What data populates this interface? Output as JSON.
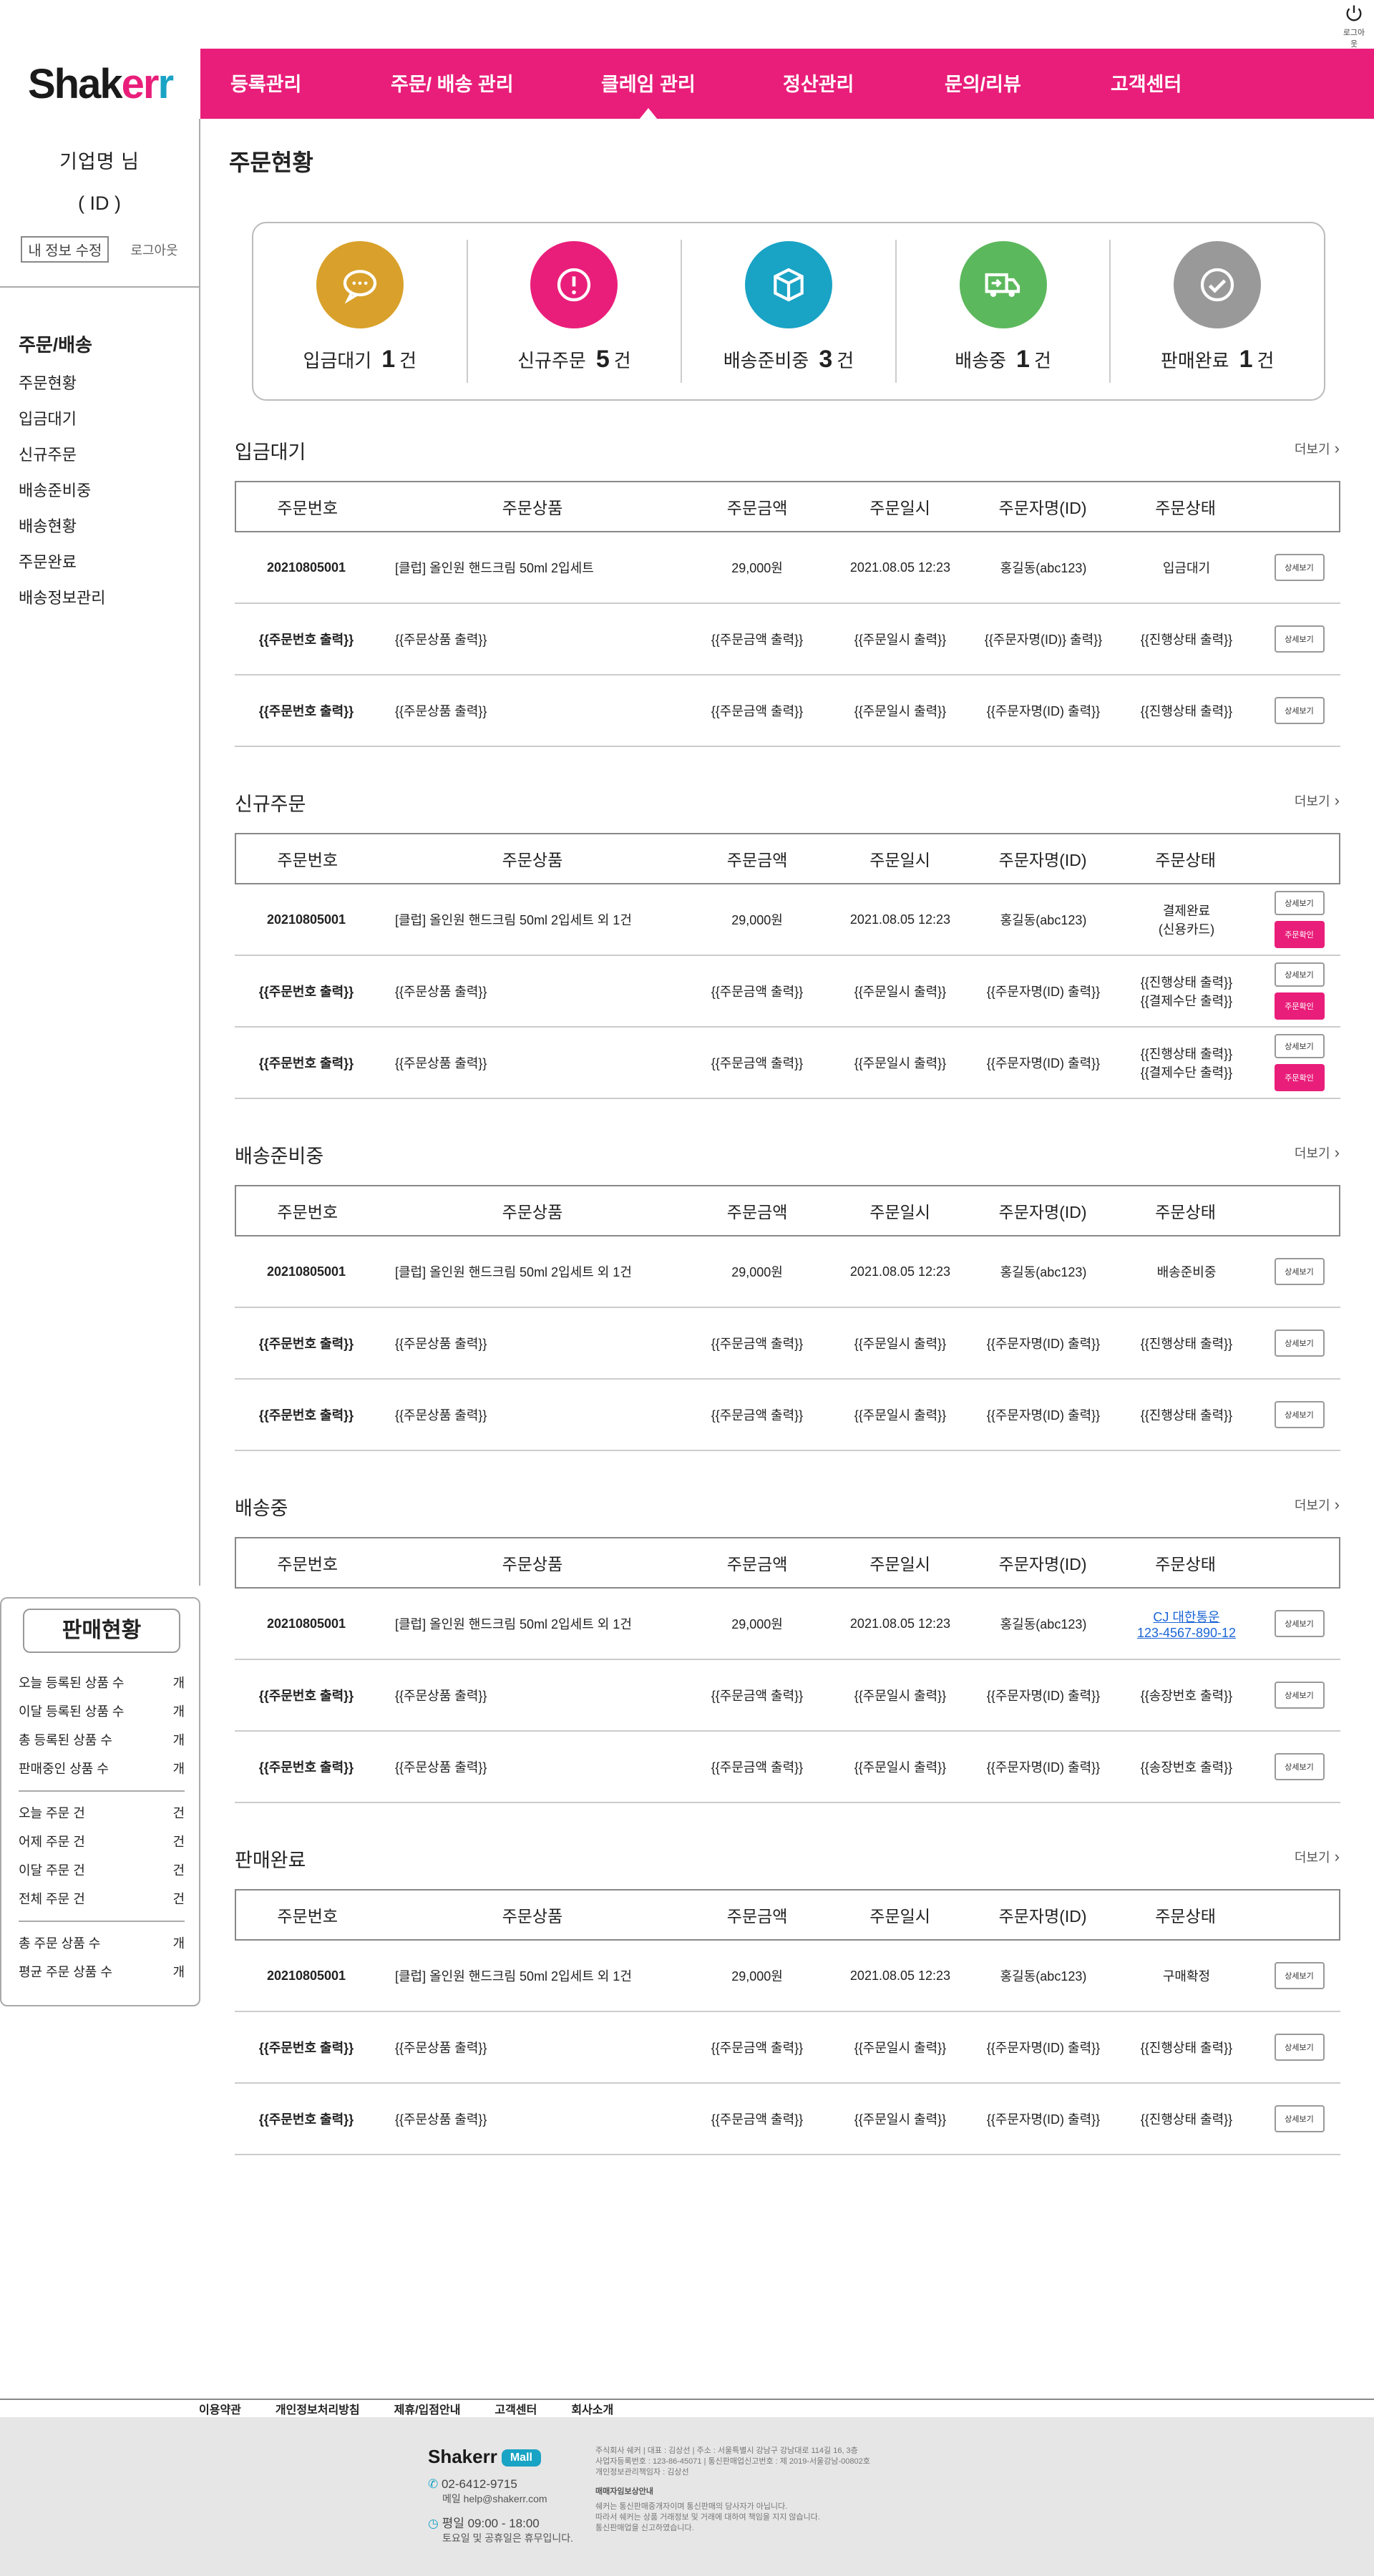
{
  "header": {
    "logout_label": "로그아웃",
    "logo_text": "Shakerr"
  },
  "nav": {
    "items": [
      {
        "label": "등록관리"
      },
      {
        "label": "주문/ 배송 관리"
      },
      {
        "label": "클레임 관리"
      },
      {
        "label": "정산관리"
      },
      {
        "label": "문의/리뷰"
      },
      {
        "label": "고객센터"
      }
    ],
    "active_index": 1
  },
  "sidebar": {
    "company": "기업명 님",
    "id": "( ID )",
    "my_info_label": "내 정보 수정",
    "logout_label": "로그아웃",
    "menu_head": "주문/배송",
    "menu": [
      "주문현황",
      "입금대기",
      "신규주문",
      "배송준비중",
      "배송현황",
      "주문완료",
      "배송정보관리"
    ]
  },
  "sales": {
    "title": "판매현황",
    "group1": [
      {
        "label": "오늘 등록된 상품 수",
        "unit": "개"
      },
      {
        "label": "이달 등록된 상품 수",
        "unit": "개"
      },
      {
        "label": "총 등록된 상품 수",
        "unit": "개"
      },
      {
        "label": "판매중인 상품 수",
        "unit": "개"
      }
    ],
    "group2": [
      {
        "label": "오늘 주문 건",
        "unit": "건"
      },
      {
        "label": "어제 주문 건",
        "unit": "건"
      },
      {
        "label": "이달 주문 건",
        "unit": "건"
      },
      {
        "label": "전체 주문 건",
        "unit": "건"
      }
    ],
    "group3": [
      {
        "label": "총 주문 상품 수",
        "unit": "개"
      },
      {
        "label": "평균 주문 상품 수",
        "unit": "개"
      }
    ]
  },
  "main": {
    "title": "주문현황"
  },
  "summary": [
    {
      "label": "입금대기",
      "count": "1",
      "unit": "건",
      "color": "#d9a12b",
      "icon": "chat-icon"
    },
    {
      "label": "신규주문",
      "count": "5",
      "unit": "건",
      "color": "#e91e7a",
      "icon": "alert-icon"
    },
    {
      "label": "배송준비중",
      "count": "3",
      "unit": "건",
      "color": "#19a3c5",
      "icon": "box-icon"
    },
    {
      "label": "배송중",
      "count": "1",
      "unit": "건",
      "color": "#5cb85c",
      "icon": "truck-icon"
    },
    {
      "label": "판매완료",
      "count": "1",
      "unit": "건",
      "color": "#999999",
      "icon": "check-icon"
    }
  ],
  "columns": [
    "주문번호",
    "주문상품",
    "주문금액",
    "주문일시",
    "주문자명(ID)",
    "주문상태"
  ],
  "more_label": "더보기",
  "detail_label": "상세보기",
  "confirm_label": "주문확인",
  "sections": [
    {
      "title": "입금대기",
      "rows": [
        {
          "no": "20210805001",
          "product": "[클럽] 올인원 핸드크림 50ml 2입세트",
          "amount": "29,000원",
          "date": "2021.08.05 12:23",
          "name": "홍길동(abc123)",
          "status": [
            "입금대기"
          ],
          "confirm": false
        },
        {
          "no": "{{주문번호 출력}}",
          "product": "{{주문상품 출력}}",
          "amount": "{{주문금액 출력}}",
          "date": "{{주문일시 출력}}",
          "name": "{{주문자명(ID)} 출력}}",
          "status": [
            "{{진행상태 출력}}"
          ],
          "confirm": false
        },
        {
          "no": "{{주문번호 출력}}",
          "product": "{{주문상품 출력}}",
          "amount": "{{주문금액 출력}}",
          "date": "{{주문일시 출력}}",
          "name": "{{주문자명(ID) 출력}}",
          "status": [
            "{{진행상태 출력}}"
          ],
          "confirm": false
        }
      ]
    },
    {
      "title": "신규주문",
      "rows": [
        {
          "no": "20210805001",
          "product": "[클럽] 올인원 핸드크림 50ml 2입세트 외 1건",
          "amount": "29,000원",
          "date": "2021.08.05 12:23",
          "name": "홍길동(abc123)",
          "status": [
            "결제완료",
            "(신용카드)"
          ],
          "confirm": true
        },
        {
          "no": "{{주문번호 출력}}",
          "product": "{{주문상품 출력}}",
          "amount": "{{주문금액 출력}}",
          "date": "{{주문일시 출력}}",
          "name": "{{주문자명(ID) 출력}}",
          "status": [
            "{{진행상태 출력}}",
            "{{결제수단 출력}}"
          ],
          "confirm": true
        },
        {
          "no": "{{주문번호 출력}}",
          "product": "{{주문상품 출력}}",
          "amount": "{{주문금액 출력}}",
          "date": "{{주문일시 출력}}",
          "name": "{{주문자명(ID) 출력}}",
          "status": [
            "{{진행상태 출력}}",
            "{{결제수단 출력}}"
          ],
          "confirm": true
        }
      ]
    },
    {
      "title": "배송준비중",
      "rows": [
        {
          "no": "20210805001",
          "product": "[클럽] 올인원 핸드크림 50ml 2입세트 외 1건",
          "amount": "29,000원",
          "date": "2021.08.05 12:23",
          "name": "홍길동(abc123)",
          "status": [
            "배송준비중"
          ],
          "confirm": false
        },
        {
          "no": "{{주문번호 출력}}",
          "product": "{{주문상품 출력}}",
          "amount": "{{주문금액 출력}}",
          "date": "{{주문일시 출력}}",
          "name": "{{주문자명(ID) 출력}}",
          "status": [
            "{{진행상태 출력}}"
          ],
          "confirm": false
        },
        {
          "no": "{{주문번호 출력}}",
          "product": "{{주문상품 출력}}",
          "amount": "{{주문금액 출력}}",
          "date": "{{주문일시 출력}}",
          "name": "{{주문자명(ID) 출력}}",
          "status": [
            "{{진행상태 출력}}"
          ],
          "confirm": false
        }
      ]
    },
    {
      "title": "배송중",
      "rows": [
        {
          "no": "20210805001",
          "product": "[클럽] 올인원 핸드크림 50ml 2입세트 외 1건",
          "amount": "29,000원",
          "date": "2021.08.05 12:23",
          "name": "홍길동(abc123)",
          "status": [
            "CJ 대한통운",
            "123-4567-890-12"
          ],
          "link": true,
          "confirm": false
        },
        {
          "no": "{{주문번호 출력}}",
          "product": "{{주문상품 출력}}",
          "amount": "{{주문금액 출력}}",
          "date": "{{주문일시 출력}}",
          "name": "{{주문자명(ID) 출력}}",
          "status": [
            "{{송장번호 출력}}"
          ],
          "confirm": false
        },
        {
          "no": "{{주문번호 출력}}",
          "product": "{{주문상품 출력}}",
          "amount": "{{주문금액 출력}}",
          "date": "{{주문일시 출력}}",
          "name": "{{주문자명(ID) 출력}}",
          "status": [
            "{{송장번호 출력}}"
          ],
          "confirm": false
        }
      ]
    },
    {
      "title": "판매완료",
      "rows": [
        {
          "no": "20210805001",
          "product": "[클럽] 올인원 핸드크림 50ml 2입세트 외 1건",
          "amount": "29,000원",
          "date": "2021.08.05 12:23",
          "name": "홍길동(abc123)",
          "status": [
            "구매확정"
          ],
          "confirm": false
        },
        {
          "no": "{{주문번호 출력}}",
          "product": "{{주문상품 출력}}",
          "amount": "{{주문금액 출력}}",
          "date": "{{주문일시 출력}}",
          "name": "{{주문자명(ID) 출력}}",
          "status": [
            "{{진행상태 출력}}"
          ],
          "confirm": false
        },
        {
          "no": "{{주문번호 출력}}",
          "product": "{{주문상품 출력}}",
          "amount": "{{주문금액 출력}}",
          "date": "{{주문일시 출력}}",
          "name": "{{주문자명(ID) 출력}}",
          "status": [
            "{{진행상태 출력}}"
          ],
          "confirm": false
        }
      ]
    }
  ],
  "footer": {
    "links": [
      "이용약관",
      "개인정보처리방침",
      "제휴/입점안내",
      "고객센터",
      "회사소개"
    ],
    "logo": "Shakerr",
    "mall": "Mall",
    "phone": "02-6412-9715",
    "email": "메일 help@shakerr.com",
    "hours": "평일 09:00 - 18:00",
    "hours_note": "토요일 및 공휴일은 휴무입니다.",
    "info": [
      "주식회사 쉐커 | 대표 : 김상선 | 주소 : 서울특별시 강남구 강남대로 114길 16, 3층",
      "사업자등록번호 : 123-86-45071 | 통신판매업신고번호 : 제 2019-서울강남-00802호",
      "개인정보관리책임자 : 김상선"
    ],
    "notice_title": "매매자임보상안내",
    "notice": [
      "쉐커는 통신판매중개자이며 통신판매의 당사자가 아닙니다.",
      "따라서 쉐커는 상품 거래정보 및 거래에 대하여 책임을 지지 않습니다.",
      "통신판매업을 신고하였습니다."
    ]
  }
}
